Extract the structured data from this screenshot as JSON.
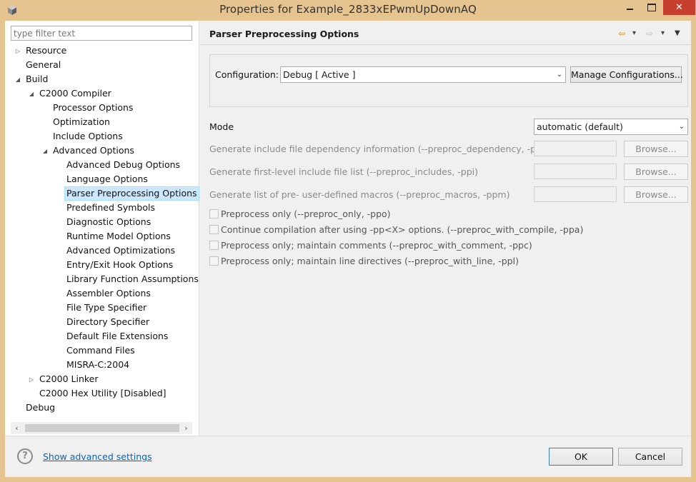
{
  "window": {
    "title": "Properties for Example_2833xEPwmUpDownAQ",
    "close_glyph": "✕"
  },
  "left": {
    "filter_placeholder": "type filter text",
    "tree": [
      {
        "label": "Resource",
        "expander": "▷"
      },
      {
        "label": "General"
      },
      {
        "label": "Build",
        "expander": "◢"
      },
      {
        "label": "C2000 Compiler",
        "expander": "◢"
      },
      {
        "label": "Processor Options"
      },
      {
        "label": "Optimization"
      },
      {
        "label": "Include Options"
      },
      {
        "label": "Advanced Options",
        "expander": "◢"
      },
      {
        "label": "Advanced Debug Options"
      },
      {
        "label": "Language Options"
      },
      {
        "label": "Parser Preprocessing Options",
        "selected": true
      },
      {
        "label": "Predefined Symbols"
      },
      {
        "label": "Diagnostic Options"
      },
      {
        "label": "Runtime Model Options"
      },
      {
        "label": "Advanced Optimizations"
      },
      {
        "label": "Entry/Exit Hook Options"
      },
      {
        "label": "Library Function Assumptions"
      },
      {
        "label": "Assembler Options"
      },
      {
        "label": "File Type Specifier"
      },
      {
        "label": "Directory Specifier"
      },
      {
        "label": "Default File Extensions"
      },
      {
        "label": "Command Files"
      },
      {
        "label": "MISRA-C:2004"
      },
      {
        "label": "C2000 Linker",
        "expander": "▷"
      },
      {
        "label": "C2000 Hex Utility  [Disabled]"
      },
      {
        "label": "Debug"
      }
    ],
    "scroll_left": "‹",
    "scroll_right": "›"
  },
  "right": {
    "page_title": "Parser Preprocessing Options",
    "nav": {
      "back": "⇦",
      "dropdown1": "▾",
      "forward": "⇨",
      "dropdown2": "▾",
      "menu": "▼"
    },
    "configuration": {
      "label": "Configuration:",
      "value": "Debug  [ Active ]",
      "manage_button": "Manage Configurations..."
    },
    "mode": {
      "label": "Mode",
      "value": "automatic (default)"
    },
    "file_options": [
      {
        "label": "Generate include file dependency information (--preproc_dependency, -ppd)",
        "button": "Browse..."
      },
      {
        "label": "Generate first-level include file list (--preproc_includes, -ppi)",
        "button": "Browse..."
      },
      {
        "label": "Generate list of pre-  user-defined macros (--preproc_macros, -ppm)",
        "button": "Browse..."
      }
    ],
    "checkboxes": [
      {
        "label": "Preprocess only (--preproc_only, -ppo)",
        "checked": false
      },
      {
        "label": "Continue compilation after using -pp<X> options. (--preproc_with_compile, -ppa)",
        "checked": false
      },
      {
        "label": "Preprocess only; maintain comments (--preproc_with_comment, -ppc)",
        "checked": false
      },
      {
        "label": "Preprocess only; maintain line directives (--preproc_with_line, -ppl)",
        "checked": false
      }
    ]
  },
  "footer": {
    "help_glyph": "?",
    "advanced_link": "Show advanced settings",
    "ok": "OK",
    "cancel": "Cancel"
  }
}
